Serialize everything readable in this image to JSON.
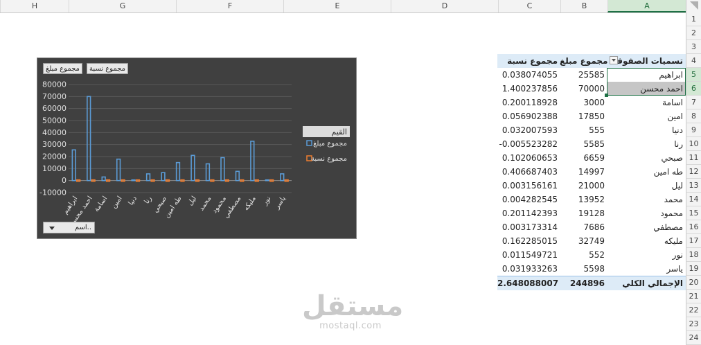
{
  "columns": [
    "H",
    "G",
    "F",
    "E",
    "D",
    "C",
    "B",
    "A"
  ],
  "rows": [
    "1",
    "2",
    "3",
    "4",
    "5",
    "6",
    "7",
    "8",
    "9",
    "10",
    "11",
    "12",
    "13",
    "14",
    "15",
    "16",
    "17",
    "18",
    "19",
    "20",
    "21",
    "22",
    "23",
    "24"
  ],
  "pivot": {
    "headers": {
      "labels": "تسميات الصفوف",
      "sum_amount": "مجموع مبلغ",
      "sum_ratio": "مجموع نسبة"
    },
    "rows": [
      {
        "name": "ابراهيم",
        "amount": "25585",
        "ratio": "0.038074055"
      },
      {
        "name": "احمد محسن",
        "amount": "70000",
        "ratio": "1.400237856"
      },
      {
        "name": "اسامة",
        "amount": "3000",
        "ratio": "0.200118928"
      },
      {
        "name": "امين",
        "amount": "17850",
        "ratio": "0.056902388"
      },
      {
        "name": "دنيا",
        "amount": "555",
        "ratio": "0.032007593"
      },
      {
        "name": "رنا",
        "amount": "5585",
        "ratio": "-0.005523282"
      },
      {
        "name": "صبحي",
        "amount": "6659",
        "ratio": "0.102060653"
      },
      {
        "name": "طه امين",
        "amount": "14997",
        "ratio": "0.406687403"
      },
      {
        "name": "ليل",
        "amount": "21000",
        "ratio": "0.003156161"
      },
      {
        "name": "محمد",
        "amount": "13952",
        "ratio": "0.004282545"
      },
      {
        "name": "محمود",
        "amount": "19128",
        "ratio": "0.201142393"
      },
      {
        "name": "مصطفي",
        "amount": "7686",
        "ratio": "0.003173314"
      },
      {
        "name": "مليكه",
        "amount": "32749",
        "ratio": "0.162285015"
      },
      {
        "name": "نور",
        "amount": "552",
        "ratio": "0.011549721"
      },
      {
        "name": "ياسر",
        "amount": "5598",
        "ratio": "0.031933263"
      }
    ],
    "total": {
      "label": "الإجمالي الكلي",
      "amount": "244896",
      "ratio": "2.648088007"
    }
  },
  "chart_buttons": {
    "sum_amount": "مجموع مبلغ",
    "sum_ratio": "مجموع نسبة",
    "name_filter": "اسم.."
  },
  "chart_data": {
    "type": "bar",
    "categories": [
      "ابراهيم",
      "احمد محسن",
      "اسامة",
      "امين",
      "دنيا",
      "رنا",
      "صبحي",
      "طه امين",
      "ليل",
      "محمد",
      "محمود",
      "مصطفي",
      "مليكه",
      "نور",
      "ياسر"
    ],
    "series": [
      {
        "name": "مجموع مبلغ",
        "color": "#5b9bd5",
        "values": [
          25585,
          70000,
          3000,
          17850,
          555,
          5585,
          6659,
          14997,
          21000,
          13952,
          19128,
          7686,
          32749,
          552,
          5598
        ]
      },
      {
        "name": "مجموع نسبة",
        "color": "#ed7d31",
        "values": [
          0.038074055,
          1.400237856,
          0.200118928,
          0.056902388,
          0.032007593,
          -0.005523282,
          0.102060653,
          0.406687403,
          0.003156161,
          0.004282545,
          0.201142393,
          0.003173314,
          0.162285015,
          0.011549721,
          0.031933263
        ]
      }
    ],
    "yticks": [
      "80000",
      "70000",
      "60000",
      "50000",
      "40000",
      "30000",
      "20000",
      "10000",
      "0",
      "-10000"
    ],
    "ylim": [
      -10000,
      80000
    ],
    "legend_title": "القيم",
    "legend_position": "right"
  },
  "watermark": {
    "arabic": "مستقل",
    "latin": "mostaql.com"
  },
  "colors": {
    "pivot_header": "#ddebf7",
    "selection": "#1e7145",
    "chart_bg": "#404040"
  }
}
